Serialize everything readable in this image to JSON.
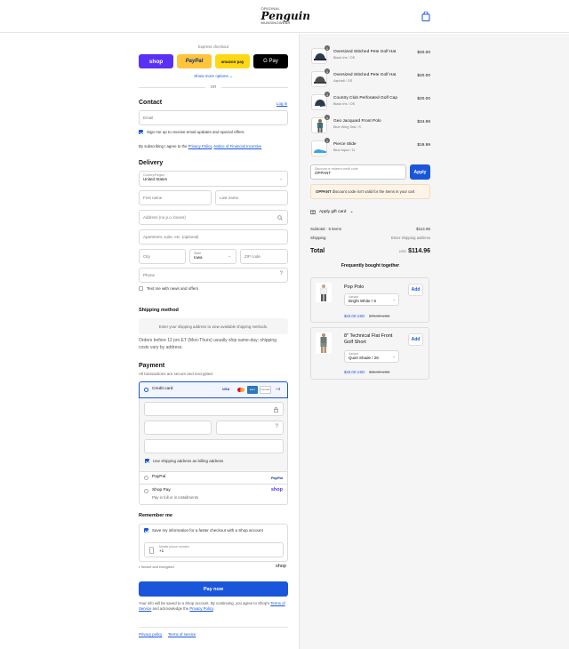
{
  "header": {
    "logo_line1": "ORIGINAL",
    "logo_name": "Penguin",
    "logo_line3": "MUNSINGWEAR"
  },
  "express": {
    "title": "Express checkout",
    "shop": "shop",
    "paypal": "PayPal",
    "amazon": "amazon pay",
    "gpay": "G Pay",
    "more": "Show more options",
    "or": "OR"
  },
  "contact": {
    "title": "Contact",
    "login": "Log in",
    "email_placeholder": "Email",
    "optin": "Sign me up to receive email updates and special offers.",
    "legal_prefix": "By subscribing I agree to the ",
    "privacy": "Privacy Policy",
    "comma": ", ",
    "notice": "Notice of Financial Incentive"
  },
  "delivery": {
    "title": "Delivery",
    "country_label": "Country/Region",
    "country": "United States",
    "first": "First name",
    "last": "Last name",
    "address": "Address (no p.o. boxes)",
    "apt": "Apartment, suite, etc. (optional)",
    "city": "City",
    "state_label": "State",
    "state": "Iowa",
    "zip": "ZIP code",
    "phone": "Phone",
    "text_me": "Text me with news and offers"
  },
  "shipping": {
    "title": "Shipping method",
    "placeholder": "Enter your shipping address to view available shipping methods.",
    "note": "Orders before 12 pm ET (Mon-Thurs) usually ship same-day; shipping costs vary by address."
  },
  "payment": {
    "title": "Payment",
    "subtitle": "All transactions are secure and encrypted.",
    "credit": "Credit card",
    "more_cards": "+4",
    "visa": "VISA",
    "amex": "AMEX",
    "discover": "DISCOVER",
    "billing": "Use shipping address as billing address",
    "paypal": "PayPal",
    "paypal_logo": "PayPal",
    "shoppay": "Shop Pay",
    "shoppay_sub": "Pay in full or in installments",
    "shoppay_logo": "shop"
  },
  "remember": {
    "title": "Remember me",
    "save": "Save my information for a faster checkout with a Shop account",
    "mobile_label": "Mobile phone number",
    "mobile": "+1",
    "secure": "Secure and encrypted",
    "shop_logo": "shop"
  },
  "pay": {
    "button": "Pay now",
    "terms1": "Your info will be saved to a Shop account. By continuing, you agree to Shop's ",
    "terms": "Terms of Service",
    "terms2": " and acknowledge the ",
    "privacy": "Privacy Policy",
    "end": "."
  },
  "footer": {
    "privacy": "Privacy policy",
    "terms": "Terms of service"
  },
  "cart": {
    "items": [
      {
        "name": "Oversized Stitched Pete Golf Hat",
        "variant": "Black Iris / OS",
        "price": "$20.00",
        "qty": "1"
      },
      {
        "name": "Oversized Stitched Pete Golf Hat",
        "variant": "Asphalt / OS",
        "price": "$20.00",
        "qty": "1"
      },
      {
        "name": "Country Club Perforated Golf Cap",
        "variant": "Black Iris / OS",
        "price": "$20.00",
        "qty": "1"
      },
      {
        "name": "Geo Jacquard Front Polo",
        "variant": "Blue Wing Teal / S",
        "price": "$34.99",
        "qty": "1"
      },
      {
        "name": "Pierce Slide",
        "variant": "Blue Aqua / 11",
        "price": "$19.99",
        "qty": "1"
      }
    ],
    "discount_label": "Discount or redeem credit code",
    "discount_value": "OPPANT",
    "apply": "Apply",
    "error_code": "OPPANT",
    "error_msg": " discount code isn't valid for the items in your cart",
    "gift": "Apply gift card",
    "subtotal_label": "Subtotal · 5 items",
    "subtotal": "$114.96",
    "shipping_label": "Shipping",
    "shipping_value": "Enter shipping address",
    "total_label": "Total",
    "currency": "USD",
    "total": "$114.96",
    "fbt_title": "Frequently bought together",
    "fbt": [
      {
        "name": "Pop Polo",
        "variant_label": "Variant",
        "variant": "Bright White / S",
        "price": "$20.00 USD",
        "compare": "$79.00 USD",
        "add": "Add"
      },
      {
        "name": "8\" Technical Flat Front Golf Short",
        "variant_label": "Variant",
        "variant": "Quiet Shade / 28",
        "price": "$40.00 USD",
        "compare": "$85.00 USD",
        "add": "Add"
      }
    ]
  },
  "colors": {
    "accent": "#1a56db",
    "shop": "#5a31f4",
    "paypal": "#ffc439",
    "amazon": "#ffd814",
    "gpay": "#000000",
    "error_bg": "#fdf4e7",
    "pay": "#1a56db"
  }
}
